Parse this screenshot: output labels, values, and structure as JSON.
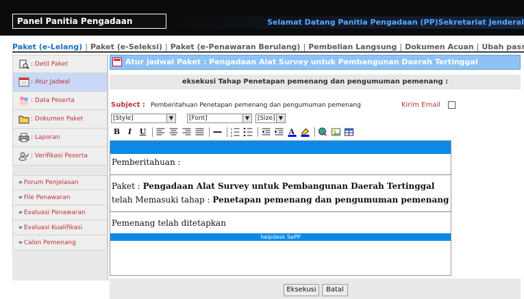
{
  "header": {
    "panel_title": "Panel Panitia Pengadaan",
    "welcome": "Selamat Datang Panitia Pengadaan (PP)Sekretariat Jenderal"
  },
  "tabs": [
    {
      "label": "Paket (e-Lelang)",
      "active": true
    },
    {
      "label": "Paket (e-Seleksi)"
    },
    {
      "label": "Paket (e-Penawaran Berulang)"
    },
    {
      "label": "Pembelian Langsung"
    },
    {
      "label": "Dokumen Acuan"
    },
    {
      "label": "Ubah password"
    }
  ],
  "sidebar": {
    "items": [
      {
        "label": ": Detil Paket",
        "icon": "document-search-icon"
      },
      {
        "label": ": Atur Jadwal",
        "icon": "calendar-icon",
        "active": true
      },
      {
        "label": ": Data Peserta",
        "icon": "users-icon"
      },
      {
        "label": ": Dokumen Paket",
        "icon": "folder-icon"
      },
      {
        "label": ": Laporan",
        "icon": "printer-icon"
      },
      {
        "label": ": Verifikasi Peserta",
        "icon": "verify-icon"
      }
    ],
    "links": [
      {
        "label": "Forum Penjelasan"
      },
      {
        "label": "File Penawaran"
      },
      {
        "label": "Evaluasi Penawaran"
      },
      {
        "label": "Evaluasi Kualifikasi"
      },
      {
        "label": "Calon Pemenang"
      }
    ]
  },
  "main": {
    "header": "Atur jadwal Paket : Pengadaan Alat Survey untuk Pembangunan Daerah Tertinggal",
    "subheader": "eksekusi Tahap Penetapan pemenang dan pengumuman pemenang :",
    "subject_label": "Subject :",
    "subject_value": "Pemberitahuan Penetapan pemenang dan pengumuman pemenang",
    "kirim_email_label": "Kirim Email",
    "style_select": "[Style]",
    "font_select": "[Font]",
    "size_select": "[Size]",
    "toolbar": {
      "bold": "B",
      "italic": "I",
      "underline": "U"
    },
    "editor": {
      "line1": "Pemberitahuan :",
      "paket_prefix": "Paket : ",
      "paket_name": "Pengadaan Alat Survey untuk Pembangunan Daerah Tertinggal",
      "tahap_prefix": "telah Memasuki tahap : ",
      "tahap_name": "Penetapan pemenang dan pengumuman pemenang",
      "line4": "Pemenang telah ditetapkan",
      "footer": "helpdesk SePP"
    },
    "buttons": {
      "eksekusi": "Eksekusi",
      "batal": "Batal"
    }
  },
  "colors": {
    "accent": "#0a8ae6",
    "header_bg": "#8ec2f4",
    "sidebar_text": "#c0303a",
    "active_tab": "#1b6fc3"
  }
}
